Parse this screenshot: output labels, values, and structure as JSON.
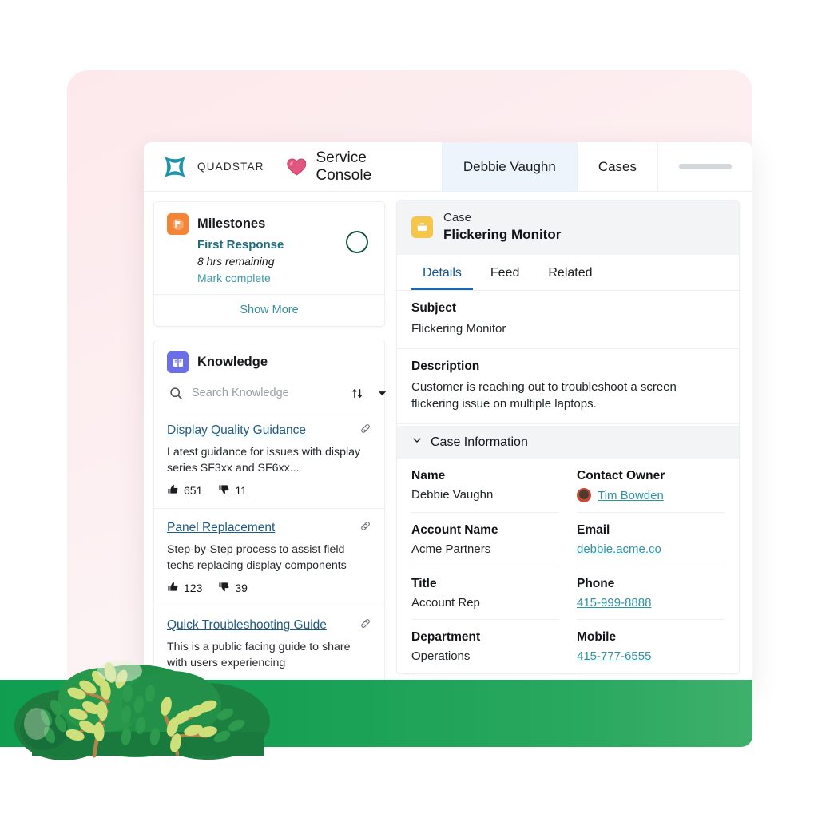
{
  "topbar": {
    "brand_name": "QUADSTAR",
    "brand_logo_icon": "quadstar-logo-icon",
    "app_icon": "heart-icon",
    "app_name": "Service Console",
    "tabs": [
      {
        "label": "Debbie Vaughn",
        "active": true
      },
      {
        "label": "Cases",
        "active": false
      }
    ]
  },
  "sidebar": {
    "milestones": {
      "icon": "flag-milestone-icon",
      "title": "Milestones",
      "item_name": "First Response",
      "time_remaining": "8 hrs remaining",
      "action_label": "Mark complete",
      "status_icon": "empty-circle-icon",
      "show_more_label": "Show More"
    },
    "knowledge": {
      "icon": "book-knowledge-icon",
      "title": "Knowledge",
      "search_placeholder": "Search Knowledge",
      "search_value": "",
      "search_icon": "search-icon",
      "sort_icon": "sort-arrows-icon",
      "filter_icon": "chevron-down-icon",
      "articles": [
        {
          "title": "Display Quality Guidance",
          "description": "Latest guidance for issues with display series SF3xx and SF6xx...",
          "thumbs_up": "651",
          "thumbs_down": "11",
          "link_icon": "attach-link-icon"
        },
        {
          "title": "Panel Replacement",
          "description": "Step-by-Step process to assist field techs replacing display components",
          "thumbs_up": "123",
          "thumbs_down": "39",
          "link_icon": "attach-link-icon"
        },
        {
          "title": "Quick Troubleshooting Guide",
          "description": "This is a public facing guide to share with users experiencing",
          "thumbs_up": "",
          "thumbs_down": "",
          "link_icon": "attach-link-icon"
        }
      ]
    }
  },
  "record": {
    "icon": "case-briefcase-icon",
    "type_label": "Case",
    "name": "Flickering Monitor",
    "tabs": [
      {
        "label": "Details",
        "active": true
      },
      {
        "label": "Feed",
        "active": false
      },
      {
        "label": "Related",
        "active": false
      }
    ],
    "fields": [
      {
        "label": "Subject",
        "value": "Flickering Monitor"
      },
      {
        "label": "Description",
        "value": "Customer is reaching out to troubleshoot a screen flickering issue on multiple laptops."
      }
    ],
    "section": {
      "title": "Case Information",
      "toggle_icon": "chevron-down-icon",
      "rows": [
        [
          {
            "label": "Name",
            "value": "Debbie Vaughn",
            "type": "text"
          },
          {
            "label": "Contact Owner",
            "value": "Tim Bowden",
            "type": "owner"
          }
        ],
        [
          {
            "label": "Account Name",
            "value": "Acme Partners",
            "type": "text"
          },
          {
            "label": "Email",
            "value": "debbie.acme.co",
            "type": "link"
          }
        ],
        [
          {
            "label": "Title",
            "value": "Account Rep",
            "type": "text"
          },
          {
            "label": "Phone",
            "value": "415-999-8888",
            "type": "link"
          }
        ],
        [
          {
            "label": "Department",
            "value": "Operations",
            "type": "text"
          },
          {
            "label": "Mobile",
            "value": "415-777-6555",
            "type": "link"
          }
        ]
      ]
    }
  },
  "decor": {
    "bush_icon": "bush-illustration",
    "band_color": "#16a053",
    "card_color": "#fdeef0"
  },
  "colors": {
    "brand_teal": "#1f94a8",
    "heart_pink": "#e0567f",
    "milestone_orange": "#f58536",
    "knowledge_purple": "#6a6fe8",
    "case_yellow": "#f5c64a",
    "link_blue": "#1d5a84",
    "link_teal": "#2f93a3",
    "tab_active_blue": "#1a66b5",
    "green": "#16a053"
  }
}
